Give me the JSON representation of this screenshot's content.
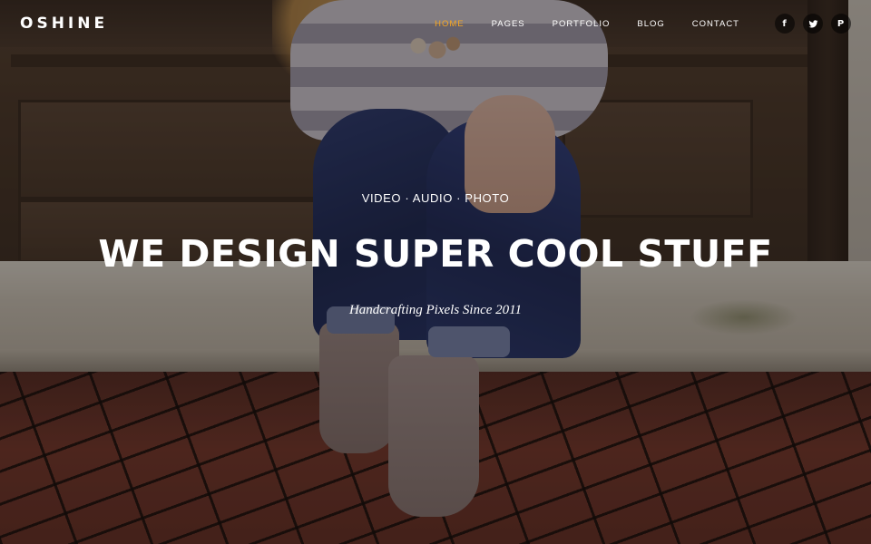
{
  "header": {
    "logo": "OSHINE",
    "nav": [
      {
        "label": "HOME",
        "active": true
      },
      {
        "label": "PAGES",
        "active": false
      },
      {
        "label": "PORTFOLIO",
        "active": false
      },
      {
        "label": "BLOG",
        "active": false
      },
      {
        "label": "CONTACT",
        "active": false
      }
    ],
    "social": [
      {
        "icon": "facebook-icon",
        "glyph": "f"
      },
      {
        "icon": "twitter-icon",
        "glyph": ""
      },
      {
        "icon": "pinterest-icon",
        "glyph": "P"
      }
    ]
  },
  "hero": {
    "tagline": "VIDEO · AUDIO · PHOTO",
    "headline": "WE DESIGN SUPER COOL STUFF",
    "subline": "Handcrafting Pixels Since 2011"
  },
  "colors": {
    "accent": "#f5a623",
    "text": "#ffffff",
    "overlay": "rgba(15,10,8,0.42)"
  }
}
